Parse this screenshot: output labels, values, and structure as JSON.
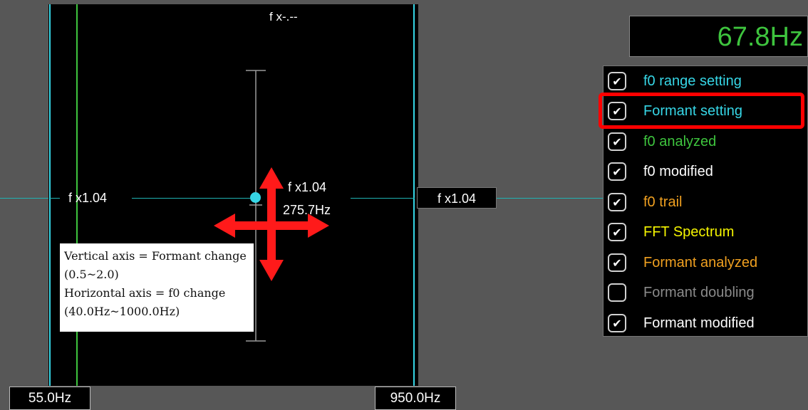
{
  "top_label": "f x-.--",
  "left_factor_label": "f x1.04",
  "center_factor_label": "f x1.04",
  "center_hz_label": "275.7Hz",
  "right_factor_label": "f x1.04",
  "bottom_left_hz": "55.0Hz",
  "bottom_right_hz": "950.0Hz",
  "freq_display": "67.8Hz",
  "tooltip": {
    "line1": "Vertical axis = Formant change",
    "line2": "(0.5~2.0)",
    "line3": "Horizontal axis = f0 change",
    "line4": "(40.0Hz~1000.0Hz)"
  },
  "checklist": [
    {
      "label": "f0 range setting",
      "checked": true,
      "color": "#36d6e6"
    },
    {
      "label": "Formant setting",
      "checked": true,
      "color": "#36d6e6"
    },
    {
      "label": "f0 analyzed",
      "checked": true,
      "color": "#3ec43e"
    },
    {
      "label": "f0 modified",
      "checked": true,
      "color": "#ffffff"
    },
    {
      "label": "f0 trail",
      "checked": true,
      "color": "#f0a020"
    },
    {
      "label": "FFT Spectrum",
      "checked": true,
      "color": "#f5f500"
    },
    {
      "label": "Formant analyzed",
      "checked": true,
      "color": "#f0a020"
    },
    {
      "label": "Formant doubling",
      "checked": false,
      "color": "#8a8a8a"
    },
    {
      "label": "Formant modified",
      "checked": true,
      "color": "#ffffff"
    }
  ],
  "colors": {
    "cyan_line": "#36d6e6",
    "green_line": "#3ec43e",
    "arrow_red": "#ff1a1a",
    "highlight_red": "#ff0000"
  },
  "icons": {
    "arrow": "move-arrows-icon",
    "check": "check-icon"
  }
}
